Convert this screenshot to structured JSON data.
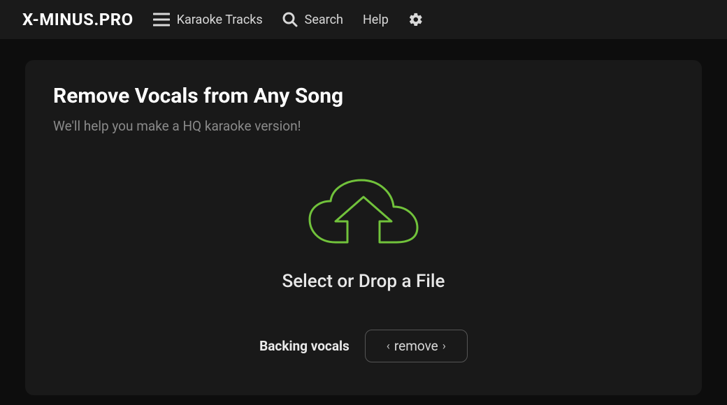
{
  "header": {
    "logo": "X-MINUS.PRO",
    "nav": {
      "karaoke": "Karaoke Tracks",
      "search": "Search",
      "help": "Help"
    }
  },
  "main": {
    "title": "Remove Vocals from Any Song",
    "subtitle": "We'll help you make a HQ karaoke version!",
    "drop_text": "Select or Drop a File",
    "option": {
      "label": "Backing vocals",
      "select_left": "‹",
      "select_value": "remove",
      "select_right": "›"
    }
  },
  "icons": {
    "menu": "menu-icon",
    "search": "search-icon",
    "gear": "gear-icon",
    "cloud_upload": "cloud-upload-icon"
  }
}
